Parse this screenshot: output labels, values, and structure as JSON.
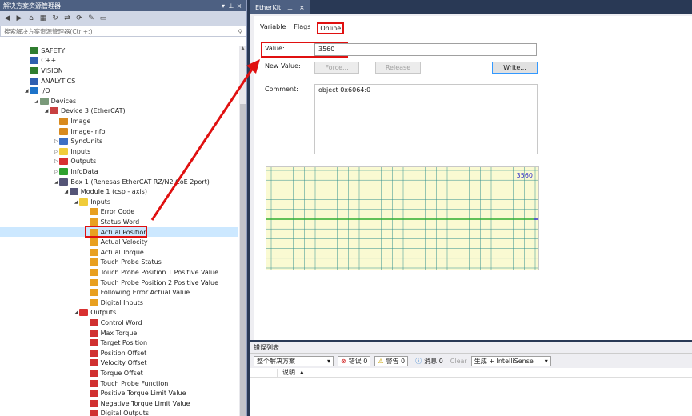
{
  "solution_explorer": {
    "title": "解决方案资源管理器",
    "title_buttons": [
      "▾",
      "⊥",
      "×"
    ],
    "search_placeholder": "搜索解决方案资源管理器(Ctrl+;)",
    "tree": [
      {
        "label": "SAFETY",
        "level": 3,
        "arrow": "",
        "icon": "safety-icon",
        "color": "#2f7d2f"
      },
      {
        "label": "C++",
        "level": 3,
        "arrow": "",
        "icon": "cpp-icon",
        "color": "#2f5fb0"
      },
      {
        "label": "VISION",
        "level": 3,
        "arrow": "",
        "icon": "vision-icon",
        "color": "#2f7d2f"
      },
      {
        "label": "ANALYTICS",
        "level": 3,
        "arrow": "",
        "icon": "analytics-icon",
        "color": "#2f5fb0"
      },
      {
        "label": "I/O",
        "level": 3,
        "arrow": "◢",
        "icon": "io-icon",
        "color": "#1d73c9"
      },
      {
        "label": "Devices",
        "level": 4,
        "arrow": "◢",
        "icon": "devices-icon",
        "color": "#7a9a7a"
      },
      {
        "label": "Device 3 (EtherCAT)",
        "level": 5,
        "arrow": "◢",
        "icon": "ethercat-device-icon",
        "color": "#c84040"
      },
      {
        "label": "Image",
        "level": 6,
        "arrow": "",
        "icon": "image-icon",
        "color": "#d88a1e"
      },
      {
        "label": "Image-Info",
        "level": 6,
        "arrow": "",
        "icon": "image-info-icon",
        "color": "#d88a1e"
      },
      {
        "label": "SyncUnits",
        "level": 6,
        "arrow": "▷",
        "icon": "syncunits-icon",
        "color": "#3c6fc4"
      },
      {
        "label": "Inputs",
        "level": 6,
        "arrow": "▷",
        "icon": "folder-yellow-icon",
        "color": "#f0cc3a"
      },
      {
        "label": "Outputs",
        "level": 6,
        "arrow": "▷",
        "icon": "folder-red-icon",
        "color": "#d83030"
      },
      {
        "label": "InfoData",
        "level": 6,
        "arrow": "▷",
        "icon": "folder-green-icon",
        "color": "#2ea02e"
      },
      {
        "label": "Box 1 (Renesas EtherCAT RZ/N2 CoE 2port)",
        "level": 6,
        "arrow": "◢",
        "icon": "box-icon",
        "color": "#555577"
      },
      {
        "label": "Module 1 (csp - axis)",
        "level": 7,
        "arrow": "◢",
        "icon": "module-icon",
        "color": "#555577"
      },
      {
        "label": "Inputs",
        "level": 8,
        "arrow": "◢",
        "icon": "folder-yellow-icon",
        "color": "#f0cc3a"
      },
      {
        "label": "Error Code",
        "level": 9,
        "arrow": "",
        "icon": "input-var-icon",
        "color": "#e8a020"
      },
      {
        "label": "Status Word",
        "level": 9,
        "arrow": "",
        "icon": "input-var-icon",
        "color": "#e8a020"
      },
      {
        "label": "Actual Position",
        "level": 9,
        "arrow": "",
        "icon": "input-var-icon",
        "color": "#e8a020"
      },
      {
        "label": "Actual Velocity",
        "level": 9,
        "arrow": "",
        "icon": "input-var-icon",
        "color": "#e8a020"
      },
      {
        "label": "Actual Torque",
        "level": 9,
        "arrow": "",
        "icon": "input-var-icon",
        "color": "#e8a020"
      },
      {
        "label": "Touch Probe Status",
        "level": 9,
        "arrow": "",
        "icon": "input-var-icon",
        "color": "#e8a020"
      },
      {
        "label": "Touch Probe Position 1 Positive Value",
        "level": 9,
        "arrow": "",
        "icon": "input-var-icon",
        "color": "#e8a020"
      },
      {
        "label": "Touch Probe Position 2 Positive Value",
        "level": 9,
        "arrow": "",
        "icon": "input-var-icon",
        "color": "#e8a020"
      },
      {
        "label": "Following Error Actual Value",
        "level": 9,
        "arrow": "",
        "icon": "input-var-icon",
        "color": "#e8a020"
      },
      {
        "label": "Digital Inputs",
        "level": 9,
        "arrow": "",
        "icon": "input-var-icon",
        "color": "#e8a020"
      },
      {
        "label": "Outputs",
        "level": 8,
        "arrow": "◢",
        "icon": "folder-red-icon",
        "color": "#d83030"
      },
      {
        "label": "Control Word",
        "level": 9,
        "arrow": "",
        "icon": "output-var-icon",
        "color": "#d03030"
      },
      {
        "label": "Max Torque",
        "level": 9,
        "arrow": "",
        "icon": "output-var-icon",
        "color": "#d03030"
      },
      {
        "label": "Target Position",
        "level": 9,
        "arrow": "",
        "icon": "output-var-icon",
        "color": "#d03030"
      },
      {
        "label": "Position Offset",
        "level": 9,
        "arrow": "",
        "icon": "output-var-icon",
        "color": "#d03030"
      },
      {
        "label": "Velocity Offset",
        "level": 9,
        "arrow": "",
        "icon": "output-var-icon",
        "color": "#d03030"
      },
      {
        "label": "Torque Offset",
        "level": 9,
        "arrow": "",
        "icon": "output-var-icon",
        "color": "#d03030"
      },
      {
        "label": "Touch Probe Function",
        "level": 9,
        "arrow": "",
        "icon": "output-var-icon",
        "color": "#d03030"
      },
      {
        "label": "Positive Torque Limit Value",
        "level": 9,
        "arrow": "",
        "icon": "output-var-icon",
        "color": "#d03030"
      },
      {
        "label": "Negative Torque Limit Value",
        "level": 9,
        "arrow": "",
        "icon": "output-var-icon",
        "color": "#d03030"
      },
      {
        "label": "Digital Outputs",
        "level": 9,
        "arrow": "",
        "icon": "output-var-icon",
        "color": "#d03030"
      }
    ],
    "selected_index": 18
  },
  "etherkit": {
    "tab_title": "EtherKit",
    "tab_buttons": [
      "⊥",
      "×"
    ],
    "subtabs": [
      "Variable",
      "Flags",
      "Online"
    ],
    "active_subtab": "Online",
    "value_label": "Value:",
    "value": "3560",
    "new_value_label": "New Value:",
    "force_label": "Force...",
    "release_label": "Release",
    "write_label": "Write...",
    "comment_label": "Comment:",
    "comment": "object 0x6064:0",
    "chart_value_label": "3560",
    "grid_color": "#2f8f8f",
    "line_color": "#2fae2f",
    "marker_color": "#3030c8"
  },
  "error_list": {
    "title": "错误列表",
    "scope": "整个解决方案",
    "errors_label": "错误 0",
    "warnings_label": "警告 0",
    "messages_label": "消息 0",
    "clear_label": "Clear",
    "build_filter": "生成 + IntelliSense",
    "column_description": "说明"
  },
  "annotation_color": "#e01010"
}
